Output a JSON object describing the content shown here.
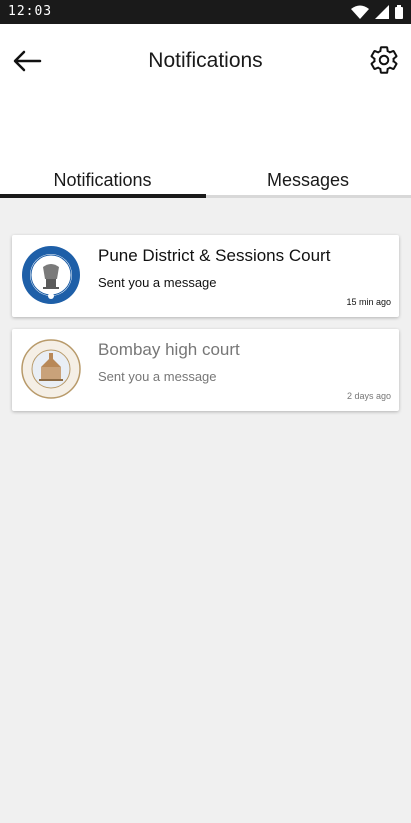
{
  "status_bar": {
    "time": "12:03"
  },
  "header": {
    "title": "Notifications"
  },
  "tabs": [
    {
      "label": "Notifications",
      "active": true
    },
    {
      "label": "Messages",
      "active": false
    }
  ],
  "notifications": [
    {
      "name": "Pune District & Sessions Court",
      "message": "Sent you a message",
      "time": "15 min ago",
      "unread": true,
      "logo_icon": "district-court-seal-icon"
    },
    {
      "name": "Bombay high court",
      "message": "Sent you a message",
      "time": "2 days ago",
      "unread": false,
      "logo_icon": "high-court-seal-icon"
    }
  ],
  "colors": {
    "accent": "#1a1a1a",
    "background": "#f0f0f0",
    "seal_blue": "#1e5fa8"
  }
}
